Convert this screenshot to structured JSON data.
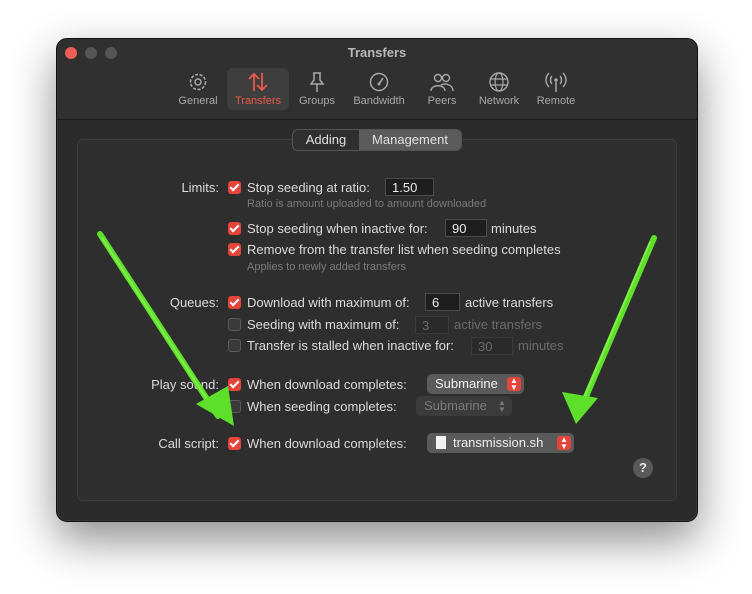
{
  "window": {
    "title": "Transfers"
  },
  "toolbar": {
    "items": [
      {
        "label": "General",
        "icon": "gear-icon"
      },
      {
        "label": "Transfers",
        "icon": "transfers-arrows-icon"
      },
      {
        "label": "Groups",
        "icon": "groups-pin-icon"
      },
      {
        "label": "Bandwidth",
        "icon": "speedometer-icon"
      },
      {
        "label": "Peers",
        "icon": "people-icon"
      },
      {
        "label": "Network",
        "icon": "globe-icon"
      },
      {
        "label": "Remote",
        "icon": "antenna-icon"
      }
    ],
    "active": "Transfers"
  },
  "tabs": {
    "adding": "Adding",
    "management": "Management",
    "selected": "Management"
  },
  "limits": {
    "label": "Limits:",
    "ratio_label": "Stop seeding at ratio:",
    "ratio_value": "1.50",
    "ratio_hint": "Ratio is amount uploaded to amount downloaded",
    "inactive_label": "Stop seeding when inactive for:",
    "inactive_value": "90",
    "inactive_unit": "minutes",
    "remove_label": "Remove from the transfer list when seeding completes",
    "remove_hint": "Applies to newly added transfers"
  },
  "queues": {
    "label": "Queues:",
    "download_label": "Download with maximum of:",
    "download_value": "6",
    "download_unit": "active transfers",
    "seeding_label": "Seeding with maximum of:",
    "seeding_value": "3",
    "seeding_unit": "active transfers",
    "stalled_label": "Transfer is stalled when inactive for:",
    "stalled_value": "30",
    "stalled_unit": "minutes"
  },
  "play_sound": {
    "label": "Play sound:",
    "download_label": "When download completes:",
    "download_sound": "Submarine",
    "seeding_label": "When seeding completes:",
    "seeding_sound": "Submarine"
  },
  "call_script": {
    "label": "Call script:",
    "download_label": "When download completes:",
    "script": "transmission.sh"
  },
  "help": "?",
  "colors": {
    "accent": "#e4453b",
    "annotation_arrow": "#5ee02a",
    "window_bg": "#2b2b2b"
  }
}
